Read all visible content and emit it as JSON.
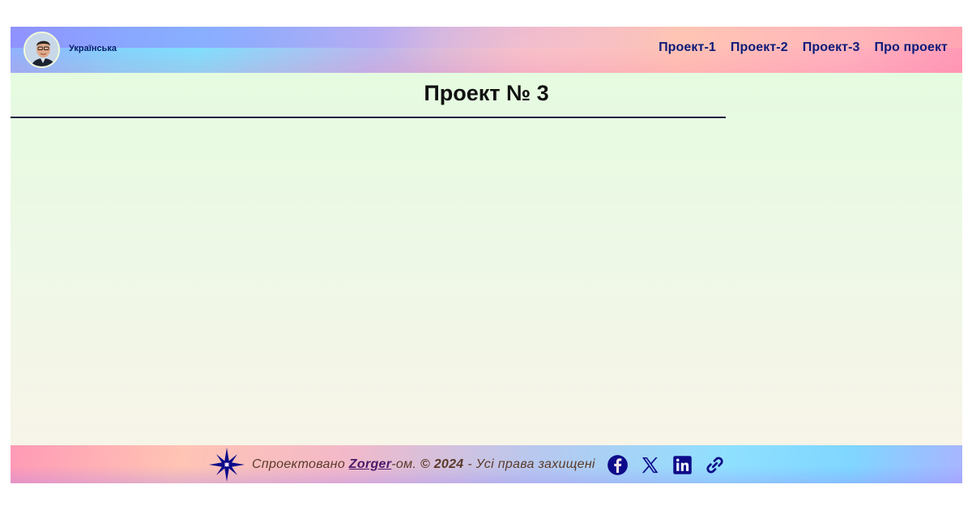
{
  "header": {
    "language": "Українська",
    "nav": [
      "Проект-1",
      "Проект-2",
      "Проект-3",
      "Про проект"
    ]
  },
  "main": {
    "title": "Проект № 3"
  },
  "footer": {
    "prefix": "Спроектовано ",
    "author": "Zorger",
    "suffix": "-ом. ",
    "year_text": "© 2024",
    "rights": " - Усі права захищені",
    "social_icons": [
      "facebook-icon",
      "x-icon",
      "linkedin-icon",
      "link-icon"
    ]
  },
  "colors": {
    "nav_text": "#0d1a7a",
    "title_text": "#111111",
    "footer_text": "#5a3a2a",
    "icon_color": "#0d0b8a"
  }
}
